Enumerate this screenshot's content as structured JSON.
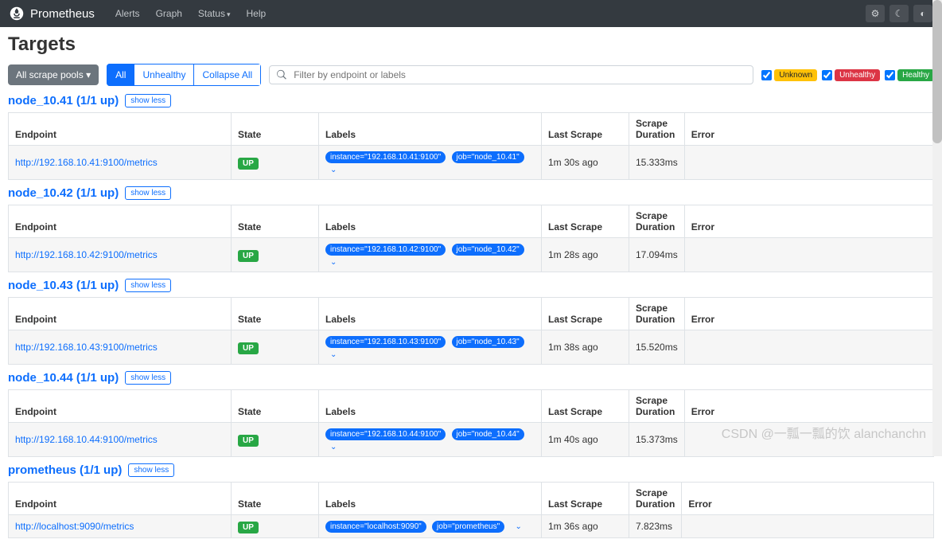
{
  "nav": {
    "brand": "Prometheus",
    "alerts": "Alerts",
    "graph": "Graph",
    "status": "Status",
    "help": "Help"
  },
  "page_title": "Targets",
  "pools_btn": "All scrape pools",
  "filters": {
    "all": "All",
    "unhealthy": "Unhealthy",
    "collapse": "Collapse All"
  },
  "search_placeholder": "Filter by endpoint or labels",
  "badges": {
    "unknown": "Unknown",
    "unhealthy": "Unhealthy",
    "healthy": "Healthy"
  },
  "headers": {
    "endpoint": "Endpoint",
    "state": "State",
    "labels": "Labels",
    "last": "Last Scrape",
    "dur": "Scrape Duration",
    "err": "Error"
  },
  "show_less": "show less",
  "state_up": "UP",
  "pools": [
    {
      "title": "node_10.41 (1/1 up)",
      "endpoint": "http://192.168.10.41:9100/metrics",
      "instance": "instance=\"192.168.10.41:9100\"",
      "job": "job=\"node_10.41\"",
      "last": "1m 30s ago",
      "dur": "15.333ms"
    },
    {
      "title": "node_10.42 (1/1 up)",
      "endpoint": "http://192.168.10.42:9100/metrics",
      "instance": "instance=\"192.168.10.42:9100\"",
      "job": "job=\"node_10.42\"",
      "last": "1m 28s ago",
      "dur": "17.094ms"
    },
    {
      "title": "node_10.43 (1/1 up)",
      "endpoint": "http://192.168.10.43:9100/metrics",
      "instance": "instance=\"192.168.10.43:9100\"",
      "job": "job=\"node_10.43\"",
      "last": "1m 38s ago",
      "dur": "15.520ms"
    },
    {
      "title": "node_10.44 (1/1 up)",
      "endpoint": "http://192.168.10.44:9100/metrics",
      "instance": "instance=\"192.168.10.44:9100\"",
      "job": "job=\"node_10.44\"",
      "last": "1m 40s ago",
      "dur": "15.373ms"
    },
    {
      "title": "prometheus (1/1 up)",
      "endpoint": "http://localhost:9090/metrics",
      "instance": "instance=\"localhost:9090\"",
      "job": "job=\"prometheus\"",
      "last": "1m 36s ago",
      "dur": "7.823ms"
    }
  ],
  "watermark": "CSDN @一瓢一瓢的饮 alanchanchn"
}
